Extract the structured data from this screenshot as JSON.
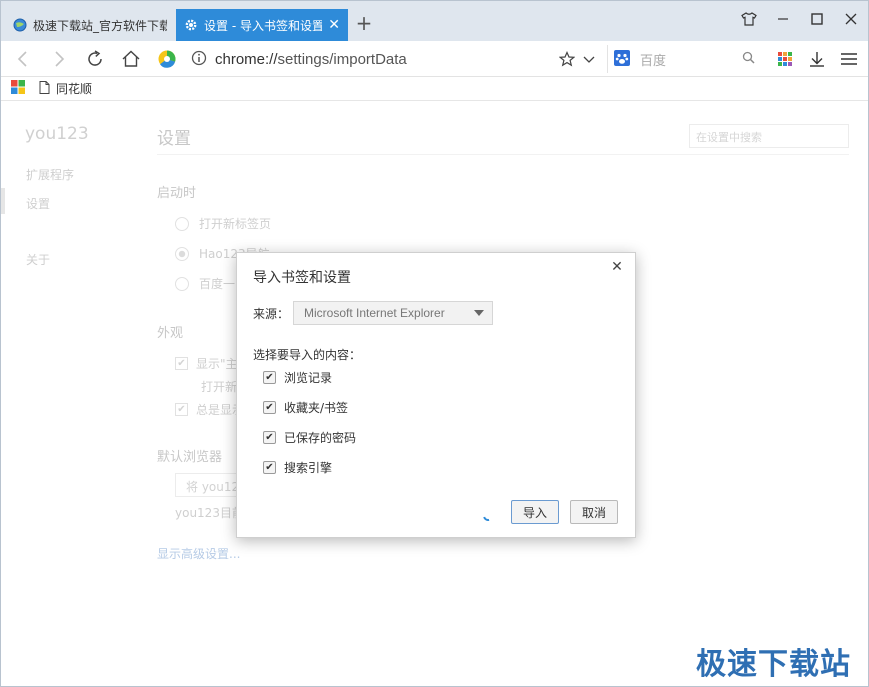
{
  "tabs": [
    {
      "title": "极速下载站_官方软件下载",
      "active": false,
      "favicon": "globe-icon"
    },
    {
      "title": "设置 - 导入书签和设置",
      "active": true,
      "favicon": "gear-icon"
    }
  ],
  "window_controls": {
    "skin": "shirt-icon",
    "minimize": "minimize-icon",
    "maximize": "maximize-icon",
    "close": "close-icon"
  },
  "address_bar": {
    "url_scheme": "chrome://",
    "url_path": "settings/importData",
    "search_placeholder": "百度"
  },
  "bookmarks": [
    {
      "label": "同花顺",
      "icon": "page-icon"
    }
  ],
  "settings_page": {
    "brand": "you123",
    "sidebar": [
      "扩展程序",
      "设置",
      "关于"
    ],
    "title": "设置",
    "search_placeholder": "在设置中搜索",
    "sections": {
      "startup": {
        "label": "启动时",
        "options": [
          "打开新标签页",
          "Hao123导航",
          "百度一"
        ]
      },
      "appearance": {
        "label": "外观",
        "show_label": "显示\"主",
        "open_label": "打开新",
        "always_label": "总是显示"
      },
      "default_browser": {
        "label": "默认浏览器",
        "button": "将 you123",
        "note": "you123目前"
      },
      "advanced_link": "显示高级设置..."
    }
  },
  "dialog": {
    "title": "导入书签和设置",
    "source_label": "来源：",
    "source_value": "Microsoft Internet Explorer",
    "choose_label": "选择要导入的内容：",
    "options": [
      {
        "label": "浏览记录",
        "checked": true
      },
      {
        "label": "收藏夹/书签",
        "checked": true
      },
      {
        "label": "已保存的密码",
        "checked": true
      },
      {
        "label": "搜索引擎",
        "checked": true
      }
    ],
    "import_button": "导入",
    "cancel_button": "取消"
  },
  "watermark": "极速下载站",
  "colors": {
    "accent": "#2e8bd9",
    "tabstrip": "#dfe6ee",
    "watermark": "#2f6fb3"
  }
}
